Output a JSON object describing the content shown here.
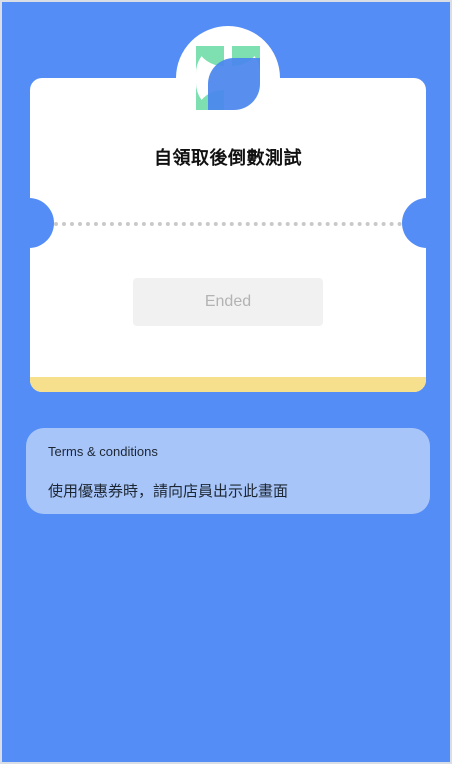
{
  "coupon": {
    "title": "自領取後倒數測試",
    "button_label": "Ended"
  },
  "terms": {
    "heading": "Terms & conditions",
    "body": "使用優惠券時，請向店員出示此畫面"
  },
  "icons": {
    "logo": "brand-logo-icon"
  },
  "colors": {
    "background": "#548df5",
    "card": "#ffffff",
    "accent_bar": "#f7e08d",
    "logo_green": "#7ee0b0",
    "logo_blue": "#4a86ee",
    "terms_card": "#a8c5fa",
    "button_disabled": "#f1f1f1"
  }
}
